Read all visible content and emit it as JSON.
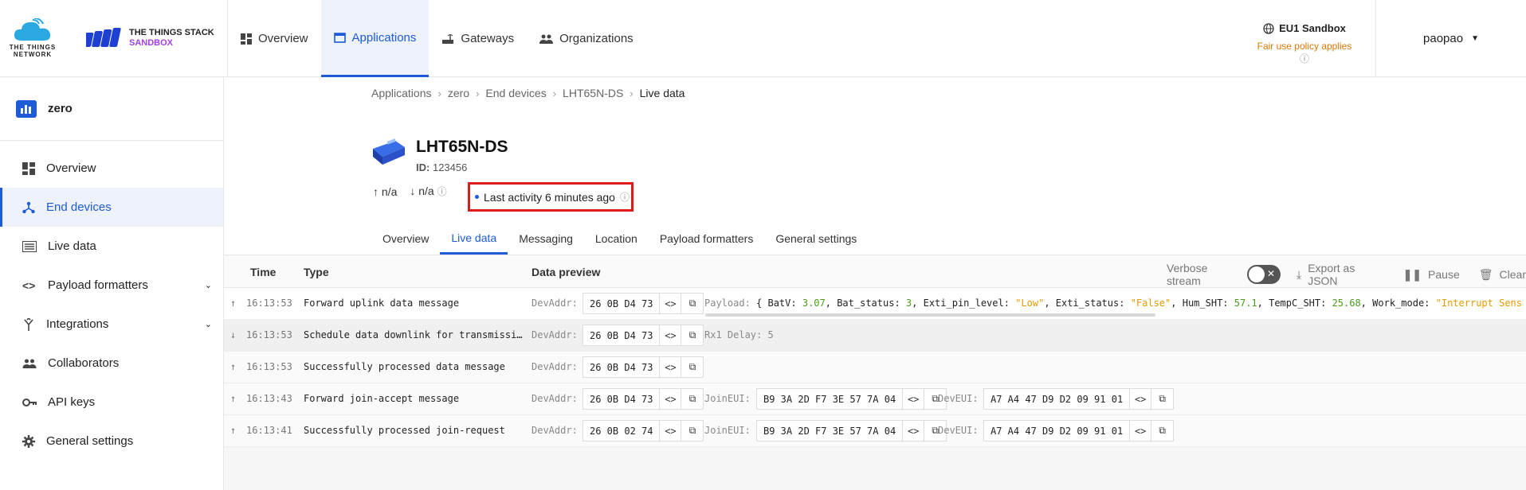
{
  "header": {
    "ttn_logo_text": "THE THINGS NETWORK",
    "tts_logo_line1": "THE THINGS STACK",
    "tts_logo_line2": "SANDBOX",
    "nav": [
      {
        "label": "Overview",
        "icon": "dashboard-icon"
      },
      {
        "label": "Applications",
        "icon": "application-icon",
        "active": true
      },
      {
        "label": "Gateways",
        "icon": "router-icon"
      },
      {
        "label": "Organizations",
        "icon": "group-icon"
      }
    ],
    "region": "EU1 Sandbox",
    "fair_use": "Fair use policy applies",
    "user": "paopao"
  },
  "sidebar": {
    "app_name": "zero",
    "items": [
      {
        "label": "Overview",
        "icon": "dashboard-icon"
      },
      {
        "label": "End devices",
        "icon": "device-hub-icon",
        "active": true
      },
      {
        "label": "Live data",
        "icon": "list-icon"
      },
      {
        "label": "Payload formatters",
        "icon": "code-icon",
        "expandable": true
      },
      {
        "label": "Integrations",
        "icon": "merge-icon",
        "expandable": true
      },
      {
        "label": "Collaborators",
        "icon": "people-icon"
      },
      {
        "label": "API keys",
        "icon": "key-icon"
      },
      {
        "label": "General settings",
        "icon": "settings-icon"
      }
    ]
  },
  "breadcrumb": [
    "Applications",
    "zero",
    "End devices",
    "LHT65N-DS",
    "Live data"
  ],
  "device": {
    "name": "LHT65N-DS",
    "id_label": "ID:",
    "id_value": "123456",
    "uplink": "n/a",
    "downlink": "n/a",
    "last_activity": "Last activity 6 minutes ago"
  },
  "tabs": [
    "Overview",
    "Live data",
    "Messaging",
    "Location",
    "Payload formatters",
    "General settings"
  ],
  "active_tab": "Live data",
  "table": {
    "headers": {
      "time": "Time",
      "type": "Type",
      "preview": "Data preview"
    },
    "verbose_label": "Verbose stream",
    "export_label": "Export as JSON",
    "pause_label": "Pause",
    "clear_label": "Clear",
    "rows": [
      {
        "direction": "up",
        "time": "16:13:53",
        "type": "Forward uplink data message",
        "devaddr_label": "DevAddr:",
        "devaddr": "26 0B D4 73",
        "payload_label": "Payload:",
        "payload": {
          "open": "{ ",
          "k1": "BatV: ",
          "v1": "3.07",
          "k2": ", Bat_status: ",
          "v2": "3",
          "k3": ", Exti_pin_level: ",
          "v3": "\"Low\"",
          "k4": ", Exti_status: ",
          "v4": "\"False\"",
          "k5": ", Hum_SHT: ",
          "v5": "57.1",
          "k6": ", TempC_SHT: ",
          "v6": "25.68",
          "k7": ", Work_mode: ",
          "v7": "\"Interrupt Sens"
        }
      },
      {
        "direction": "down",
        "time": "16:13:53",
        "type": "Schedule data downlink for transmissi…",
        "devaddr_label": "DevAddr:",
        "devaddr": "26 0B D4 73",
        "extra": "Rx1 Delay: 5"
      },
      {
        "direction": "up",
        "time": "16:13:53",
        "type": "Successfully processed data message",
        "devaddr_label": "DevAddr:",
        "devaddr": "26 0B D4 73"
      },
      {
        "direction": "up",
        "time": "16:13:43",
        "type": "Forward join-accept message",
        "devaddr_label": "DevAddr:",
        "devaddr": "26 0B D4 73",
        "joineui_label": "JoinEUI:",
        "joineui": "B9 3A 2D F7 3E 57 7A 04",
        "deveui_label": "DevEUI:",
        "deveui": "A7 A4 47 D9 D2 09 91 01"
      },
      {
        "direction": "up",
        "time": "16:13:41",
        "type": "Successfully processed join-request",
        "devaddr_label": "DevAddr:",
        "devaddr": "26 0B 02 74",
        "joineui_label": "JoinEUI:",
        "joineui": "B9 3A 2D F7 3E 57 7A 04",
        "deveui_label": "DevEUI:",
        "deveui": "A7 A4 47 D9 D2 09 91 01"
      }
    ]
  },
  "colors": {
    "accent": "#1d5bd7",
    "highlight_box": "#e01b1b",
    "number": "#4a9c1c",
    "string": "#e59a00",
    "fair_use": "#d97706"
  }
}
